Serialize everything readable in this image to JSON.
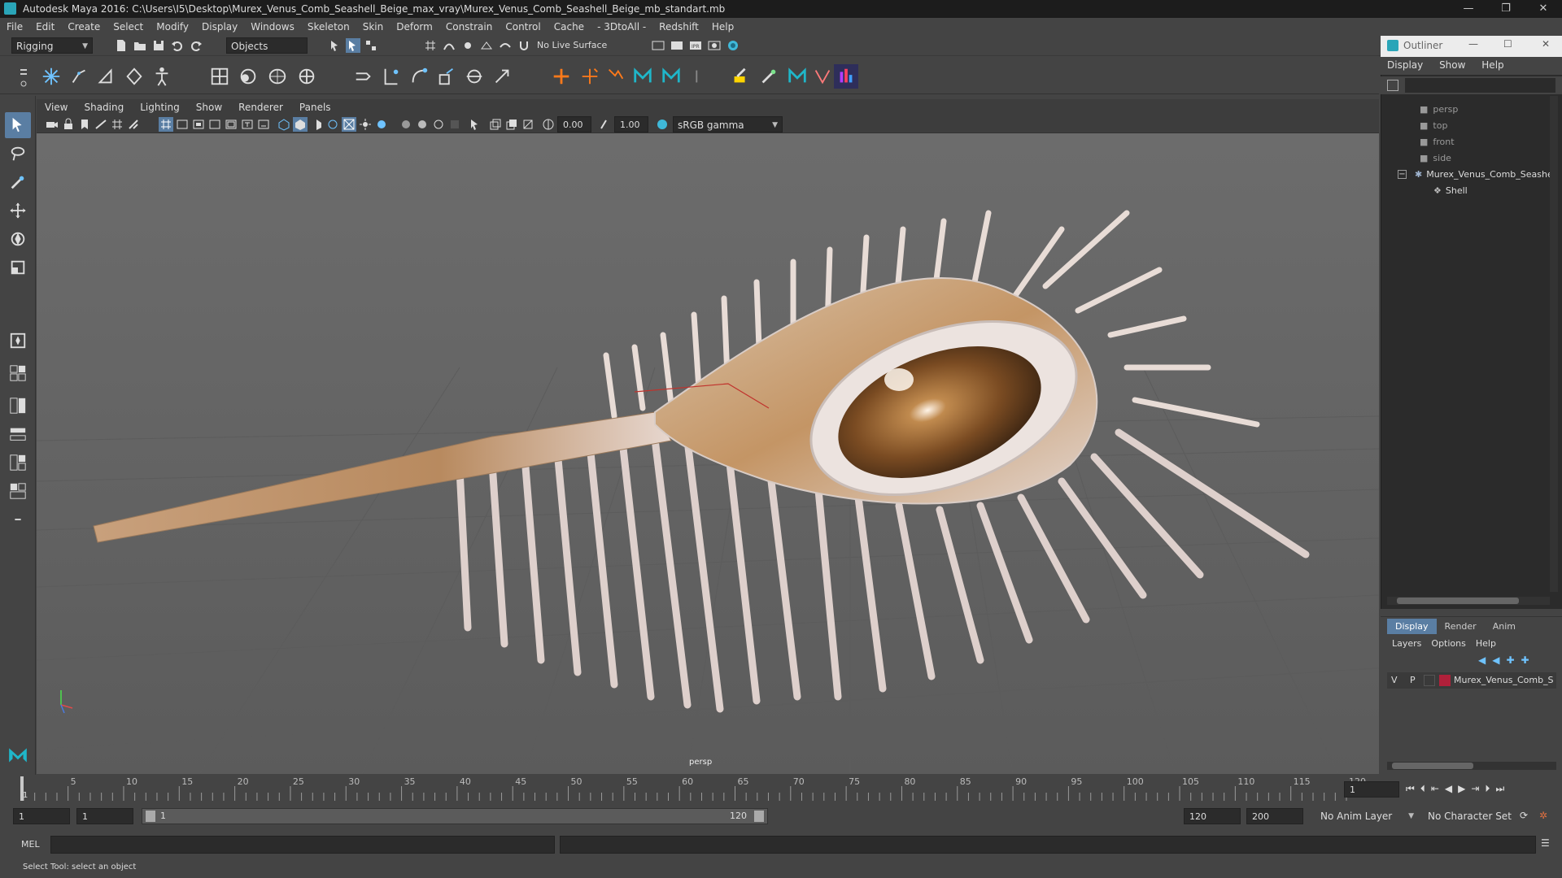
{
  "window": {
    "title": "Autodesk Maya 2016: C:\\Users\\I5\\Desktop\\Murex_Venus_Comb_Seashell_Beige_max_vray\\Murex_Venus_Comb_Seashell_Beige_mb_standart.mb",
    "min": "—",
    "max": "❐",
    "close": "✕"
  },
  "menubar": [
    "File",
    "Edit",
    "Create",
    "Select",
    "Modify",
    "Display",
    "Windows",
    "Skeleton",
    "Skin",
    "Deform",
    "Constrain",
    "Control",
    "Cache",
    "- 3DtoAll -",
    "Redshift",
    "Help"
  ],
  "statusline": {
    "menuset": "Rigging",
    "selection_mask": "Objects",
    "live_surface": "No Live Surface"
  },
  "viewport": {
    "menu": [
      "View",
      "Shading",
      "Lighting",
      "Show",
      "Renderer",
      "Panels"
    ],
    "exposure": "0.00",
    "gamma": "1.00",
    "colorspace": "sRGB gamma",
    "camera_label": "persp"
  },
  "outliner": {
    "title": "Outliner",
    "menu": [
      "Display",
      "Show",
      "Help"
    ],
    "items": [
      {
        "label": "persp",
        "dim": true
      },
      {
        "label": "top",
        "dim": true
      },
      {
        "label": "front",
        "dim": true
      },
      {
        "label": "side",
        "dim": true
      },
      {
        "label": "Murex_Venus_Comb_Seashe",
        "dim": false
      },
      {
        "label": "Shell",
        "dim": false
      }
    ]
  },
  "layers": {
    "tabs": [
      "Display",
      "Render",
      "Anim"
    ],
    "active_tab": "Display",
    "menu": [
      "Layers",
      "Options",
      "Help"
    ],
    "row": {
      "v": "V",
      "p": "P",
      "name": "Murex_Venus_Comb_S",
      "color": "#b0203a"
    }
  },
  "timeline": {
    "ticks": [
      "5",
      "10",
      "15",
      "20",
      "25",
      "30",
      "35",
      "40",
      "45",
      "50",
      "55",
      "60",
      "65",
      "70",
      "75",
      "80",
      "85",
      "90",
      "95",
      "100",
      "105",
      "110",
      "115",
      "120"
    ],
    "start_marker": "1",
    "current_frame": "1"
  },
  "range": {
    "start": "1",
    "playback_start": "1",
    "slider_start": "1",
    "slider_end": "120",
    "playback_end": "120",
    "end": "200",
    "anim_layer": "No Anim Layer",
    "character_set": "No Character Set"
  },
  "cmdline": {
    "label": "MEL"
  },
  "helpline": {
    "text": "Select Tool: select an object"
  },
  "colors": {
    "accent": "#5a7ea3",
    "viewport_bg": "#686868",
    "panel_bg": "#444444"
  }
}
